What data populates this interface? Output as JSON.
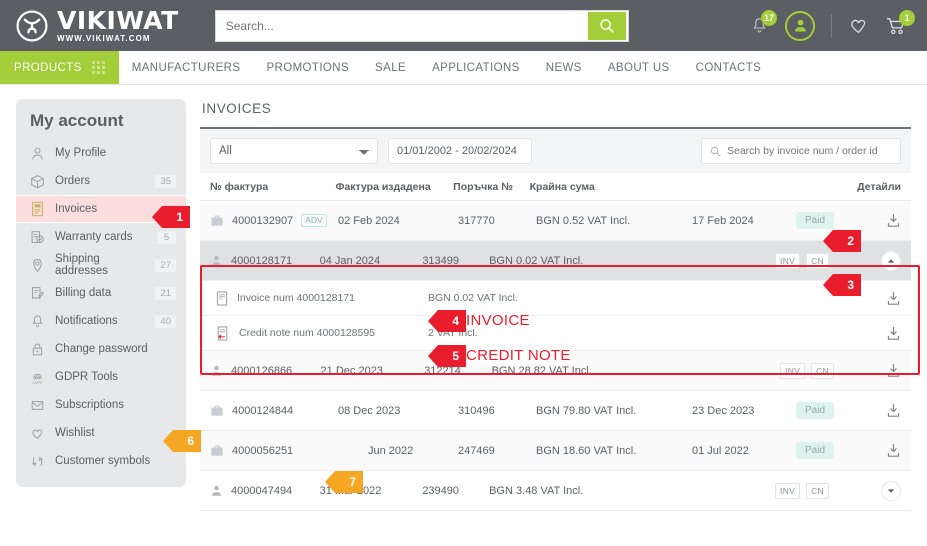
{
  "header": {
    "logo_name": "VIKIWAT",
    "logo_sub": "WWW.VIKIWAT.COM",
    "search_placeholder": "Search...",
    "search_value": "",
    "notifications_count": "17",
    "cart_count": "1"
  },
  "nav": {
    "products_label": "PRODUCTS",
    "items": [
      {
        "label": "MANUFACTURERS"
      },
      {
        "label": "PROMOTIONS"
      },
      {
        "label": "SALE"
      },
      {
        "label": "APPLICATIONS"
      },
      {
        "label": "NEWS"
      },
      {
        "label": "ABOUT US"
      },
      {
        "label": "CONTACTS"
      }
    ]
  },
  "sidebar": {
    "title": "My account",
    "items": [
      {
        "label": "My Profile",
        "count": "",
        "icon": "user-icon"
      },
      {
        "label": "Orders",
        "count": "35",
        "icon": "box-icon"
      },
      {
        "label": "Invoices",
        "count": "",
        "icon": "invoice-icon",
        "active": true
      },
      {
        "label": "Warranty cards",
        "count": "5",
        "icon": "warranty-icon"
      },
      {
        "label": "Shipping addresses",
        "count": "27",
        "icon": "pin-icon"
      },
      {
        "label": "Billing data",
        "count": "21",
        "icon": "billing-icon"
      },
      {
        "label": "Notifications",
        "count": "40",
        "icon": "bell-icon"
      },
      {
        "label": "Change password",
        "count": "",
        "icon": "lock-icon"
      },
      {
        "label": "GDPR Tools",
        "count": "",
        "icon": "gdpr-icon"
      },
      {
        "label": "Subscriptions",
        "count": "",
        "icon": "envelope-icon"
      },
      {
        "label": "Wishlist",
        "count": "",
        "icon": "heart-icon"
      },
      {
        "label": "Customer symbols",
        "count": "",
        "icon": "symbols-icon"
      }
    ]
  },
  "main": {
    "title": "INVOICES",
    "filters": {
      "select_value": "All",
      "select_options": [
        "All"
      ],
      "date_range": "01/01/2002 - 20/02/2024",
      "search_placeholder": "Search by invoice num / order id",
      "search_value": ""
    },
    "columns": {
      "number": "№ фактура",
      "issued": "Фактура издадена",
      "order": "Поръчка №",
      "total": "Крайна сума",
      "details": "Детайли"
    },
    "rows": [
      {
        "number": "4000132907",
        "tag": "ADV",
        "icon": "briefcase-icon",
        "issued": "02 Feb 2024",
        "order": "317770",
        "total": "BGN 0.52 VAT Incl.",
        "paid_on": "17 Feb 2024",
        "status": "Paid",
        "mini_tags": [],
        "action": "download-icon"
      },
      {
        "number": "4000128171",
        "tag": "",
        "icon": "person-icon",
        "issued": "04 Jan 2024",
        "order": "313499",
        "total": "BGN 0.02 VAT Incl.",
        "paid_on": "",
        "status": "",
        "mini_tags": [
          "INV",
          "CN"
        ],
        "action": "chevron-up-icon",
        "expanded": true
      },
      {
        "number": "4000126866",
        "tag": "",
        "icon": "person-icon",
        "issued": "21 Dec 2023",
        "order": "312214",
        "total": "BGN 28.82 VAT Incl.",
        "paid_on": "",
        "status": "",
        "mini_tags": [
          "INV",
          "CN"
        ],
        "action": "download-icon"
      },
      {
        "number": "4000124844",
        "tag": "",
        "icon": "briefcase-icon",
        "issued": "08 Dec 2023",
        "order": "310496",
        "total": "BGN 79.80 VAT Incl.",
        "paid_on": "23 Dec 2023",
        "status": "Paid",
        "mini_tags": [],
        "action": "download-icon"
      },
      {
        "number": "4000056251",
        "tag": "",
        "icon": "briefcase-icon",
        "issued": "Jun 2022",
        "order": "247469",
        "total": "BGN 18.60 VAT Incl.",
        "paid_on": "01 Jul 2022",
        "status": "Paid",
        "mini_tags": [],
        "action": "download-icon"
      },
      {
        "number": "4000047494",
        "tag": "",
        "icon": "person-icon",
        "issued": "31 Mar 2022",
        "order": "239490",
        "total": "BGN 3.48 VAT Incl.",
        "paid_on": "",
        "status": "",
        "mini_tags": [
          "INV",
          "CN"
        ],
        "action": "chevron-down-icon"
      }
    ],
    "subrows": [
      {
        "label": "Invoice num 4000128171",
        "icon": "document-icon",
        "total": "BGN 0.02 VAT Incl.",
        "action": "download-icon"
      },
      {
        "label": "Credit note num 4000128595",
        "icon": "credit-note-icon",
        "total": "2 VAT Incl.",
        "action": "download-icon"
      }
    ]
  },
  "annotations": [
    {
      "num": "1",
      "color": "#ea1d2c"
    },
    {
      "num": "2",
      "color": "#ea1d2c"
    },
    {
      "num": "3",
      "color": "#ea1d2c"
    },
    {
      "num": "4",
      "color": "#ea1d2c"
    },
    {
      "num": "5",
      "color": "#ea1d2c"
    },
    {
      "num": "6",
      "color": "#f5a623"
    },
    {
      "num": "7",
      "color": "#f5a623"
    }
  ],
  "overlay_labels": {
    "invoice": "INVOICE",
    "credit_note": "CREDIT NOTE"
  },
  "colors": {
    "brand_green": "#a3cd39",
    "header_grey": "#5b5f63",
    "annotation_red": "#ea1d2c",
    "annotation_orange": "#f5a623",
    "paid_badge_bg": "#ddf3ee"
  }
}
